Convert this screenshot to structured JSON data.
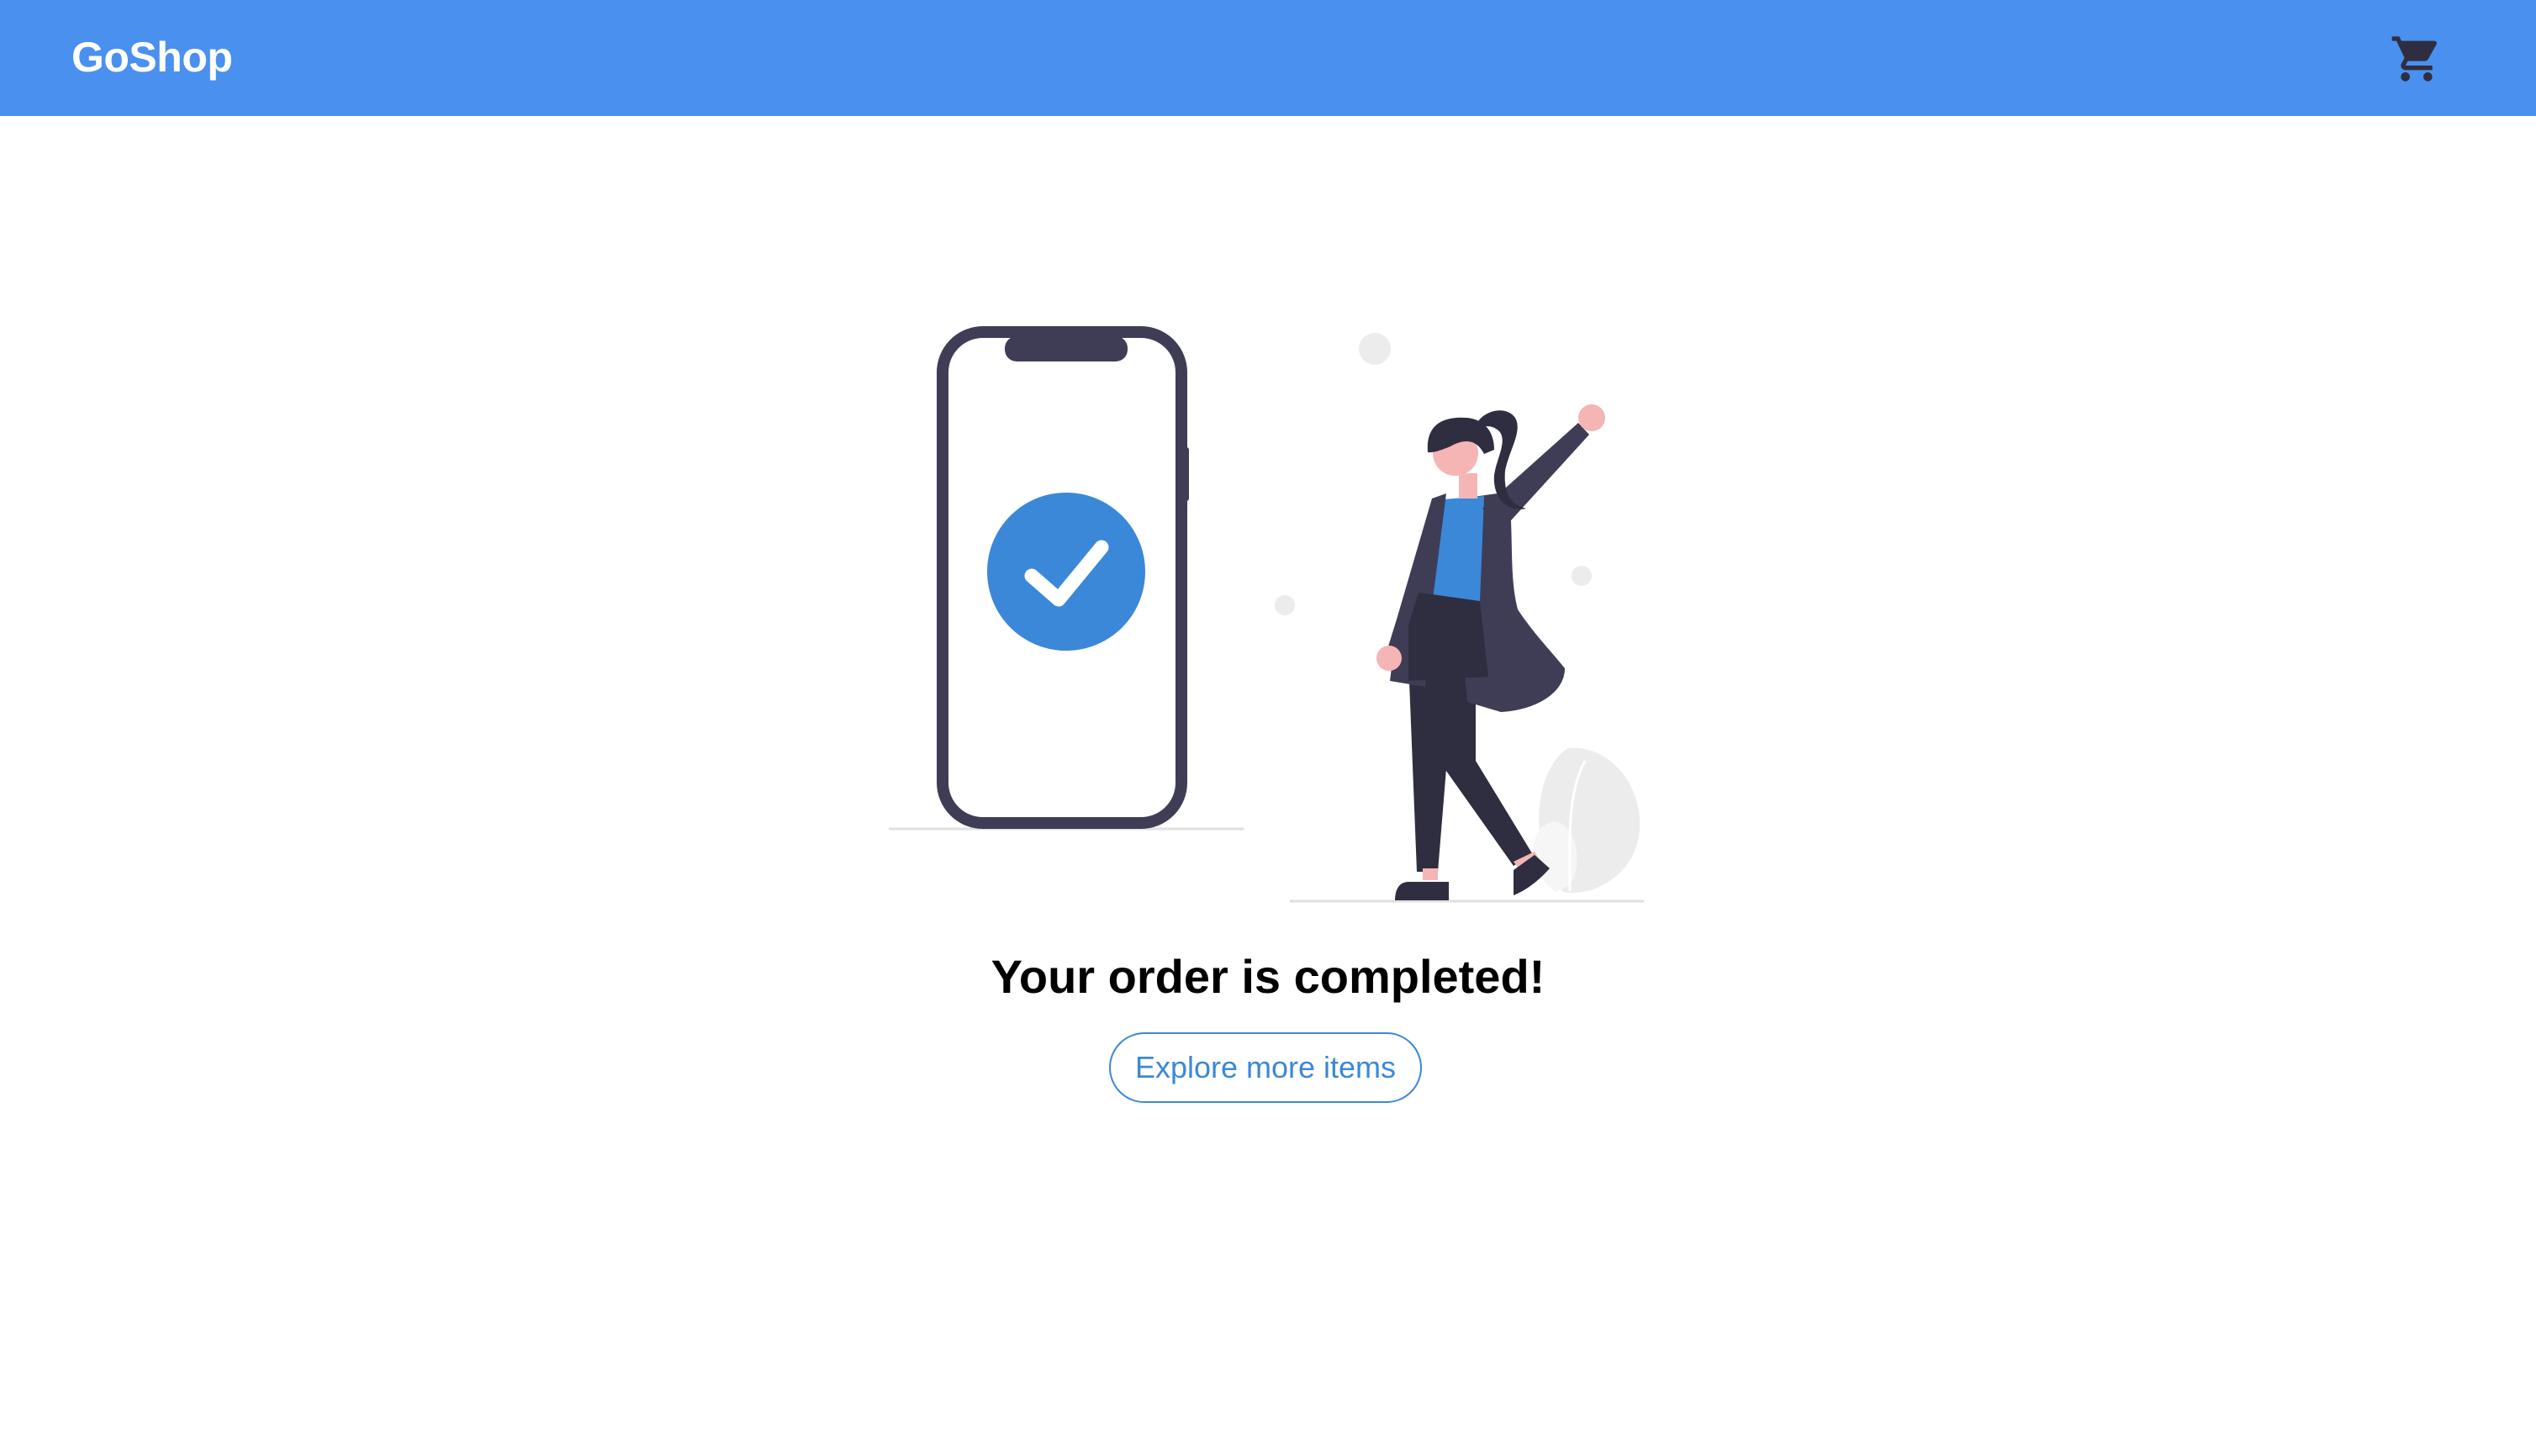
{
  "header": {
    "brand": "GoShop",
    "cart_icon": "shopping-cart-icon"
  },
  "main": {
    "illustration_icon": "order-complete-illustration",
    "title": "Your order is completed!",
    "explore_button": "Explore more items"
  },
  "colors": {
    "navbar": "#4a90ef",
    "accent": "#3b88d8",
    "figure_dark": "#3f3d56",
    "title": "#000000"
  }
}
